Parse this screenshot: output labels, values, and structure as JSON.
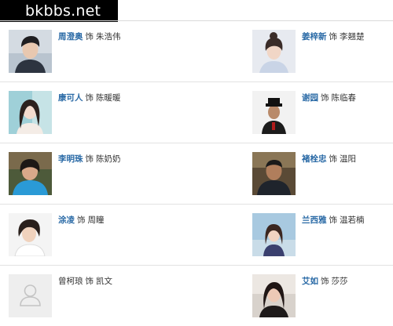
{
  "watermark": "bkbbs.net",
  "as_word": "饰",
  "cast": [
    {
      "actor": "周澄奥",
      "role": "朱浩伟",
      "linked": true,
      "photo": "man-short-hair"
    },
    {
      "actor": "姜梓新",
      "role": "李翘楚",
      "linked": true,
      "photo": "woman-updo"
    },
    {
      "actor": "康可人",
      "role": "陈暖暖",
      "linked": true,
      "photo": "woman-long-hair"
    },
    {
      "actor": "谢园",
      "role": "陈临春",
      "linked": true,
      "photo": "man-hat"
    },
    {
      "actor": "李明珠",
      "role": "陈奶奶",
      "linked": true,
      "photo": "woman-blue-top"
    },
    {
      "actor": "褚栓忠",
      "role": "温阳",
      "linked": true,
      "photo": "man-dark-jacket"
    },
    {
      "actor": "涂凌",
      "role": "周瞳",
      "linked": true,
      "photo": "woman-short-hair"
    },
    {
      "actor": "兰西雅",
      "role": "温若楠",
      "linked": true,
      "photo": "woman-outdoor"
    },
    {
      "actor": "曾柯琅",
      "role": "凯文",
      "linked": false,
      "photo": "placeholder-person"
    },
    {
      "actor": "艾如",
      "role": "莎莎",
      "linked": true,
      "photo": "woman-dark-hair"
    }
  ]
}
